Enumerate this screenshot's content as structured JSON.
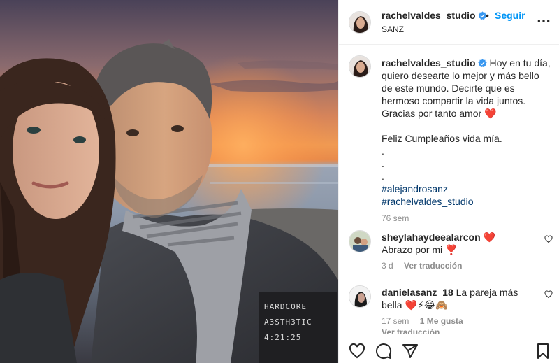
{
  "post": {
    "username": "rachelvaldes_studio",
    "follow_label": "Seguir",
    "separator": "•",
    "location": "SANZ",
    "caption_username": "rachelvaldes_studio",
    "caption_text": "Hoy en tu día, quiero desearte lo mejor y más bello de este mundo. Decirte que es hermoso compartir la vida juntos. Gracias por tanto amor ❤️\n\nFeliz Cumpleaños vida mía.\n.\n.\n.",
    "hashtags": [
      "#alejandrosanz",
      "#rachelvaldes_studio"
    ],
    "caption_time": "76 sem"
  },
  "photo": {
    "overlay_lines": [
      "HARDCORE",
      "A3STH3TIC",
      "4:21:25"
    ]
  },
  "comments": [
    {
      "username": "sheylahaydeealarcon",
      "text": "❤️ Abrazo por mi ❣️",
      "time": "3 d",
      "translate_label": "Ver traducción"
    },
    {
      "username": "danielasanz_18",
      "text": "La pareja más bella ❤️⚡😂🙈",
      "time": "17 sem",
      "likes_label": "1 Me gusta",
      "translate_label": "Ver traducción"
    }
  ],
  "icons": {
    "verified": "verified-badge-icon",
    "more": "more-options-icon",
    "like": "heart-icon",
    "comment": "comment-icon",
    "share": "share-icon",
    "save": "bookmark-icon"
  },
  "colors": {
    "accent": "#0095f6",
    "hashtag": "#00376b",
    "muted": "#8e8e8e",
    "text": "#262626",
    "border": "#efefef"
  }
}
